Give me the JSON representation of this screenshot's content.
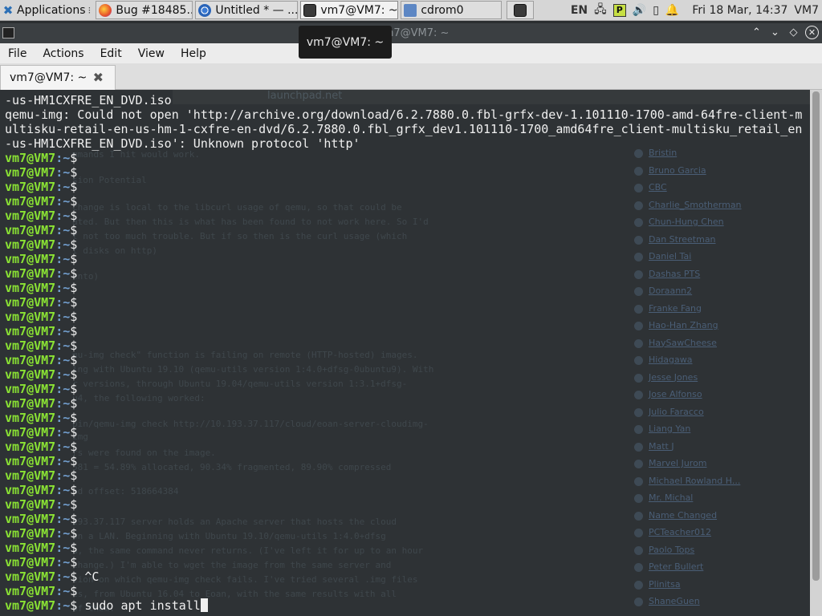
{
  "panel": {
    "applications_label": "Applications",
    "tasks": [
      {
        "label": "Bug #18485...",
        "icon": "firefox-icon"
      },
      {
        "label": "Untitled * — ...",
        "icon": "chrome-icon"
      },
      {
        "label": "vm7@VM7: ~",
        "icon": "terminal-icon"
      },
      {
        "label": "cdrom0",
        "icon": "folder-icon"
      }
    ],
    "lang": "EN",
    "clock": "Fri 18 Mar, 14:37",
    "user": "VM7"
  },
  "window": {
    "title": "vm7@VM7: ~",
    "tooltip": "vm7@VM7: ~"
  },
  "menu": [
    "File",
    "Actions",
    "Edit",
    "View",
    "Help"
  ],
  "tab": {
    "label": "vm7@VM7: ~"
  },
  "prompt": {
    "user": "vm7@VM7",
    "path": ":~",
    "symbol": "$"
  },
  "terminal": {
    "output_lines": [
      "-us-HM1CXFRE_EN_DVD.iso",
      "qemu-img: Could not open 'http://archive.org/download/6.2.7880.0.fbl-grfx-dev-1.101110-1700-amd-64fre-client-m",
      "ultisku-retail-en-us-hm-1-cxfre-en-dvd/6.2.7880.0.fbl_grfx_dev1.101110-1700_amd64fre_client-multisku_retail_en",
      "-us-HM1CXFRE_EN_DVD.iso': Unknown protocol 'http'"
    ],
    "prompt_commands": [
      "",
      "",
      "",
      "",
      "",
      "",
      "",
      "",
      "",
      "",
      "",
      "",
      "",
      "",
      "",
      "",
      "",
      "",
      "",
      "",
      "",
      "",
      "",
      "",
      "",
      "",
      "",
      "",
      "",
      "^C",
      "",
      "sudo apt install"
    ]
  },
  "background_page": {
    "url": "launchpad.net",
    "text_lines": [
      "mmands I hit would work.",
      "sion Potential",
      "change is local to the libcurl usage of qemu, so that could be",
      "ated. But then this is what has been found to not work here. So I'd",
      "t not too much trouble. But if so then is the curl usage (which",
      "t disks on http)",
      "ento)",
      "mu-img check\" function is failing on remote (HTTP-hosted) images.",
      "ing with Ubuntu 19.10 (qemu-utils version 1:4.0+dfsg-0ubuntu9). With",
      "r versions, through Ubuntu 19.04/qemu-utils version 1:3.1+dfsg-",
      "u4, the following worked:",
      "bin/qemu-img check http://10.193.37.117/cloud/eoan-server-cloudimg-",
      "img",
      "rs were found on the image.",
      "581 = 54.89% allocated, 90.34% fragmented, 89.90% compressed",
      "nd offset: 518664384",
      "193.37.117 server holds an Apache server that hosts the cloud",
      "on a LAN. Beginning with Ubuntu 19.10/qemu-utils 1:4.0+dfsg",
      "u, the same command never returns. (I've left it for up to an hour",
      "change.) I'm able to wget the image from the same server and",
      "tion on which qemu-img check fails. I've tried several .img files",
      "es, from Ubuntu 16.04 to Eoan, with the same results with all",
      "of them."
    ],
    "names": [
      "Bristin",
      "Bruno Garcia",
      "CBC",
      "Charlie_Smotherman",
      "Chun-Hung Chen",
      "Dan Streetman",
      "Daniel Tai",
      "Dashas PTS",
      "Doraann2",
      "Franke Fang",
      "Hao-Han Zhang",
      "HaySawCheese",
      "Hidagawa",
      "Jesse Jones",
      "Jose Alfonso",
      "Julio Faracco",
      "Liang Yan",
      "Matt J",
      "Marvel Jurom",
      "Michael Rowland H...",
      "Mr. Michal",
      "Name Changed",
      "PCTeacher012",
      "Paolo Tops",
      "Peter Bullert",
      "Plinitsa",
      "ShaneGuen"
    ]
  },
  "colors": {
    "terminal_bg": "#2e3235",
    "prompt_user": "#8ae234",
    "prompt_path": "#729fcf",
    "terminal_fg": "#f0f0f0"
  }
}
